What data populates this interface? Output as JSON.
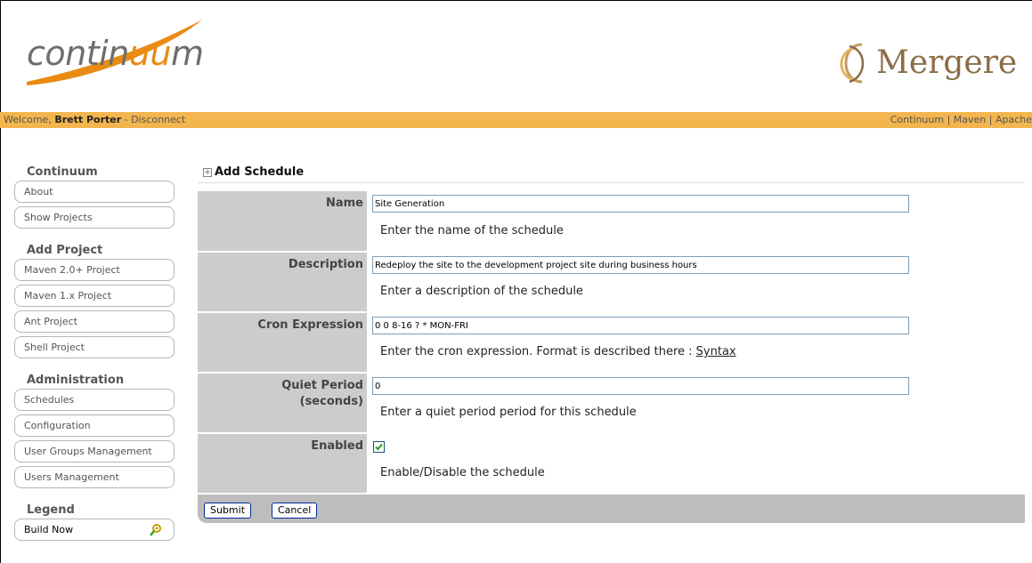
{
  "header": {
    "logo_prefix": "contin",
    "logo_accent": "uu",
    "logo_suffix": "m",
    "partner_logo": "Mergere"
  },
  "topbar": {
    "welcome": "Welcome,",
    "user": "Brett Porter",
    "disconnect": "- Disconnect",
    "links": "Continuum | Maven | Apache"
  },
  "sidebar": {
    "sections": [
      {
        "title": "Continuum",
        "items": [
          "About",
          "Show Projects"
        ]
      },
      {
        "title": "Add Project",
        "items": [
          "Maven 2.0+ Project",
          "Maven 1.x Project",
          "Ant Project",
          "Shell Project"
        ]
      },
      {
        "title": "Administration",
        "items": [
          "Schedules",
          "Configuration",
          "User Groups Management",
          "Users Management"
        ]
      },
      {
        "title": "Legend",
        "items": [
          "Build Now"
        ]
      }
    ]
  },
  "form": {
    "title": "Add Schedule",
    "toggle_glyph": "+",
    "rows": [
      {
        "label": "Name",
        "value": "Site Generation",
        "help": "Enter the name of the schedule"
      },
      {
        "label": "Description",
        "value": "Redeploy the site to the development project site during business hours",
        "help": "Enter a description of the schedule"
      },
      {
        "label": "Cron Expression",
        "value": "0 0 8-16 ? * MON-FRI",
        "help": "Enter the cron expression. Format is described there : ",
        "help_link": "Syntax"
      },
      {
        "label_line1": "Quiet Period",
        "label_line2": "(seconds)",
        "value": "0",
        "help": "Enter a quiet period period for this schedule"
      },
      {
        "label": "Enabled",
        "checked": true,
        "help": "Enable/Disable the schedule"
      }
    ],
    "submit": "Submit",
    "cancel": "Cancel"
  },
  "colors": {
    "topbar": "#f3b54d",
    "accent": "#e98b12",
    "label_bg": "#cccccc"
  },
  "icons": {
    "build_now": "build-now-icon",
    "collapse_toggle": "section-toggle-icon"
  }
}
